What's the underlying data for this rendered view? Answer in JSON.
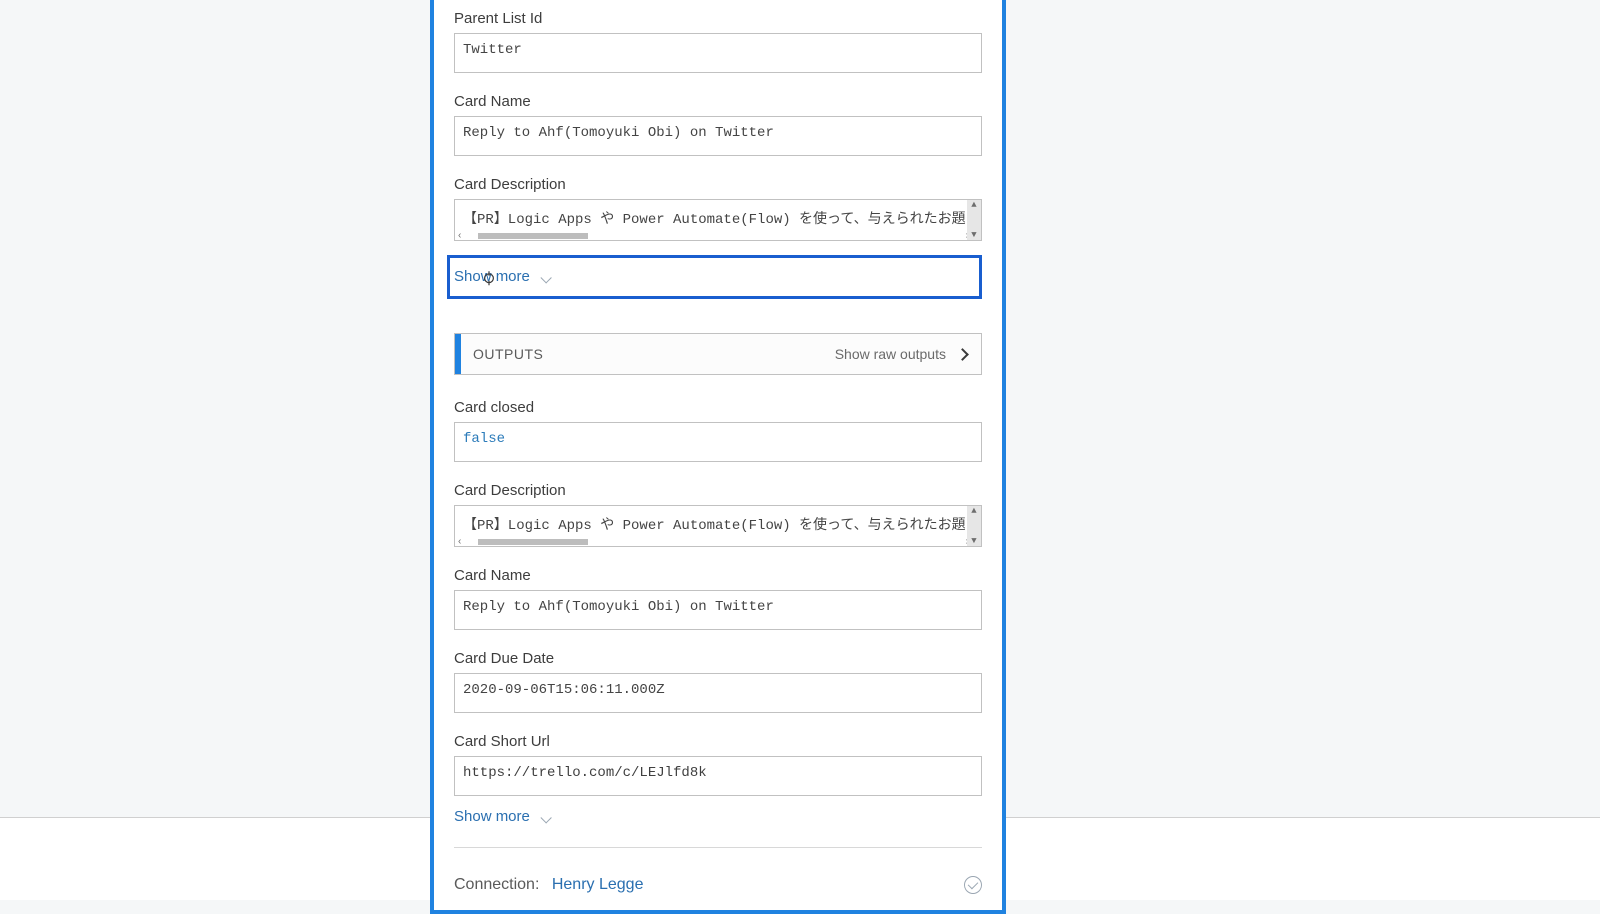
{
  "inputs": {
    "parent_list_id": {
      "label": "Parent List Id",
      "value": "Twitter"
    },
    "card_name": {
      "label": "Card Name",
      "value": "Reply to Ahf(Tomoyuki Obi) on Twitter"
    },
    "card_desc": {
      "label": "Card Description",
      "value": "【PR】Logic Apps や Power Automate(Flow) を使って、与えられたお題を"
    },
    "show_more": "Show more"
  },
  "outputs": {
    "header": "OUTPUTS",
    "raw_link": "Show raw outputs",
    "card_closed": {
      "label": "Card closed",
      "value": "false"
    },
    "card_desc": {
      "label": "Card Description",
      "value": "【PR】Logic Apps や Power Automate(Flow) を使って、与えられたお題を"
    },
    "card_name": {
      "label": "Card Name",
      "value": "Reply to Ahf(Tomoyuki Obi) on Twitter"
    },
    "due_date": {
      "label": "Card Due Date",
      "value": "2020-09-06T15:06:11.000Z"
    },
    "short_url": {
      "label": "Card Short Url",
      "value": "https://trello.com/c/LEJlfd8k"
    },
    "show_more": "Show more"
  },
  "connection": {
    "label": "Connection:",
    "name": "Henry Legge"
  }
}
